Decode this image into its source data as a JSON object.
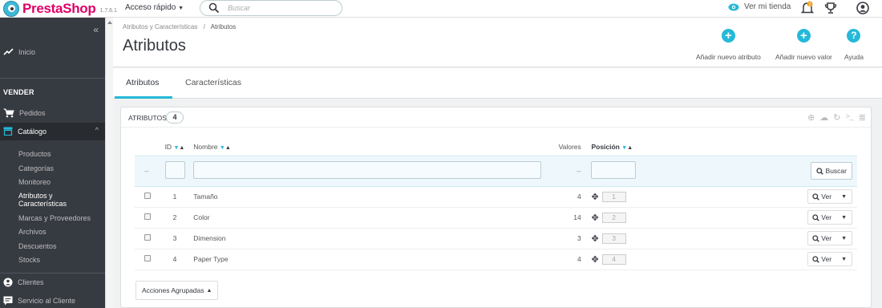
{
  "header": {
    "brand": "PrestaShop",
    "version": "1.7.6.1",
    "quick_access": "Acceso rápido",
    "search_placeholder": "Buscar",
    "view_shop": "Ver mi tienda",
    "notification_count": "2"
  },
  "sidebar": {
    "home": "Inicio",
    "section_sell": "VENDER",
    "items": [
      {
        "label": "Pedidos",
        "icon": "cart-icon"
      },
      {
        "label": "Catálogo",
        "icon": "store-icon"
      },
      {
        "label": "Clientes",
        "icon": "user-icon"
      },
      {
        "label": "Servicio al Cliente",
        "icon": "chat-icon"
      }
    ],
    "catalog_sub": [
      "Productos",
      "Categorías",
      "Monitoreo",
      "Atributos y Características",
      "Marcas y Proveedores",
      "Archivos",
      "Descuentos",
      "Stocks"
    ]
  },
  "breadcrumb": {
    "parent": "Atributos y Características",
    "separator": "/",
    "current": "Atributos"
  },
  "page_title": "Atributos",
  "toolbar": {
    "add_attribute": "Añadir nuevo atributo",
    "add_value": "Añadir nuevo valor",
    "help": "Ayuda"
  },
  "tabs": [
    "Atributos",
    "Características"
  ],
  "panel": {
    "title": "ATRIBUTOS",
    "count": "4",
    "columns": {
      "id": "ID",
      "name": "Nombre",
      "values": "Valores",
      "position": "Posición"
    },
    "filter_dash": "--",
    "search_button": "Buscar",
    "rows": [
      {
        "id": "1",
        "name": "Tamaño",
        "values": "4",
        "position": "1"
      },
      {
        "id": "2",
        "name": "Color",
        "values": "14",
        "position": "2"
      },
      {
        "id": "3",
        "name": "Dimension",
        "values": "3",
        "position": "3"
      },
      {
        "id": "4",
        "name": "Paper Type",
        "values": "4",
        "position": "4"
      }
    ],
    "view_button": "Ver",
    "bulk_actions": "Acciones Agrupadas"
  },
  "colors": {
    "accent": "#25b9d7",
    "brand": "#df0067",
    "sidebar_bg": "#363a41"
  }
}
